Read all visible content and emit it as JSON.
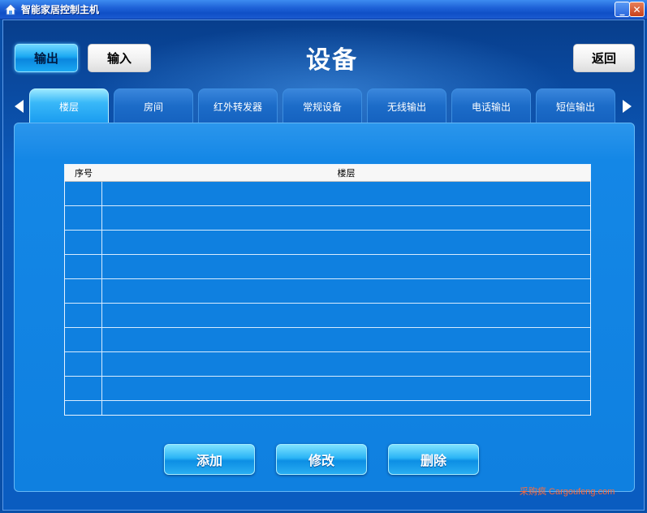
{
  "window": {
    "title": "智能家居控制主机",
    "minimize_label": "_",
    "close_label": "✕"
  },
  "header": {
    "output_label": "输出",
    "input_label": "输入",
    "title": "设备",
    "back_label": "返回"
  },
  "tabs": [
    {
      "label": "楼层",
      "active": true
    },
    {
      "label": "房间",
      "active": false
    },
    {
      "label": "红外转发器",
      "active": false
    },
    {
      "label": "常规设备",
      "active": false
    },
    {
      "label": "无线输出",
      "active": false
    },
    {
      "label": "电话输出",
      "active": false
    },
    {
      "label": "短信输出",
      "active": false
    }
  ],
  "table": {
    "columns": [
      "序号",
      "楼层"
    ],
    "rows": []
  },
  "actions": {
    "add_label": "添加",
    "edit_label": "修改",
    "delete_label": "删除"
  },
  "watermark": "采购疯 Cargoufeng.com",
  "colors": {
    "accent": "#1aa8f2",
    "panel": "#0f80e0",
    "titlebar": "#1f63d8"
  }
}
